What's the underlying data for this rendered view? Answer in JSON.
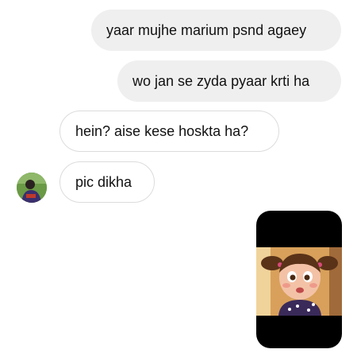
{
  "messages": [
    {
      "side": "sent",
      "text": "yaar mujhe marium psnd agaey"
    },
    {
      "side": "sent",
      "text": "wo jan se zyda pyaar krti ha"
    },
    {
      "side": "received",
      "text": "hein? aise kese hoskta ha?"
    },
    {
      "side": "received",
      "text": "pic dikha"
    }
  ],
  "avatar_icon": "user-avatar",
  "attachment": {
    "kind": "image",
    "subject": "cartoon girl with pigtails"
  },
  "colors": {
    "sent_bubble": "#efefef",
    "received_border": "#dcdcdc",
    "text": "#111111",
    "background": "#ffffff"
  }
}
